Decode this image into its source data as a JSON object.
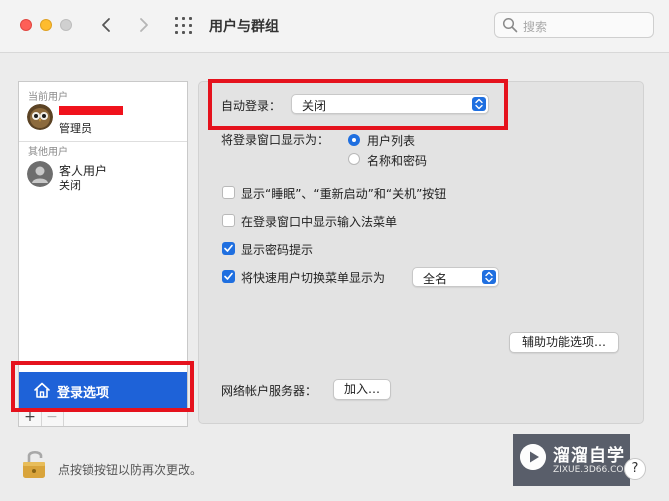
{
  "window": {
    "title": "用户与群组",
    "search_placeholder": "搜索"
  },
  "sidebar": {
    "current_users_label": "当前用户",
    "current_user": {
      "role": "管理员"
    },
    "other_users_label": "其他用户",
    "guest_user": {
      "name": "客人用户",
      "status": "关闭"
    },
    "login_options_label": "登录选项",
    "add_label": "+",
    "remove_label": "−"
  },
  "panel": {
    "auto_login_label": "自动登录：",
    "auto_login_value": "关闭",
    "display_login_as_label": "将登录窗口显示为：",
    "radio_user_list": "用户列表",
    "radio_name_password": "名称和密码",
    "cb_sleep_restart_shutdown": "显示“睡眠”、“重新启动”和“关机”按钮",
    "cb_input_menu": "在登录窗口中显示输入法菜单",
    "cb_password_hints": "显示密码提示",
    "cb_fast_user_switch": "将快速用户切换菜单显示为",
    "fast_user_switch_value": "全名",
    "accessibility_button": "辅助功能选项…",
    "network_server_label": "网络帐户服务器：",
    "join_button": "加入…"
  },
  "footer": {
    "lock_text": "点按锁按钮以防再次更改。",
    "help_label": "?"
  },
  "watermark": {
    "title": "溜溜自学",
    "subtitle": "ZIXUE.3D66.COM"
  },
  "colors": {
    "accent": "#1f6fe0",
    "selection": "#1e62d8",
    "highlight_box": "#e5121d"
  }
}
